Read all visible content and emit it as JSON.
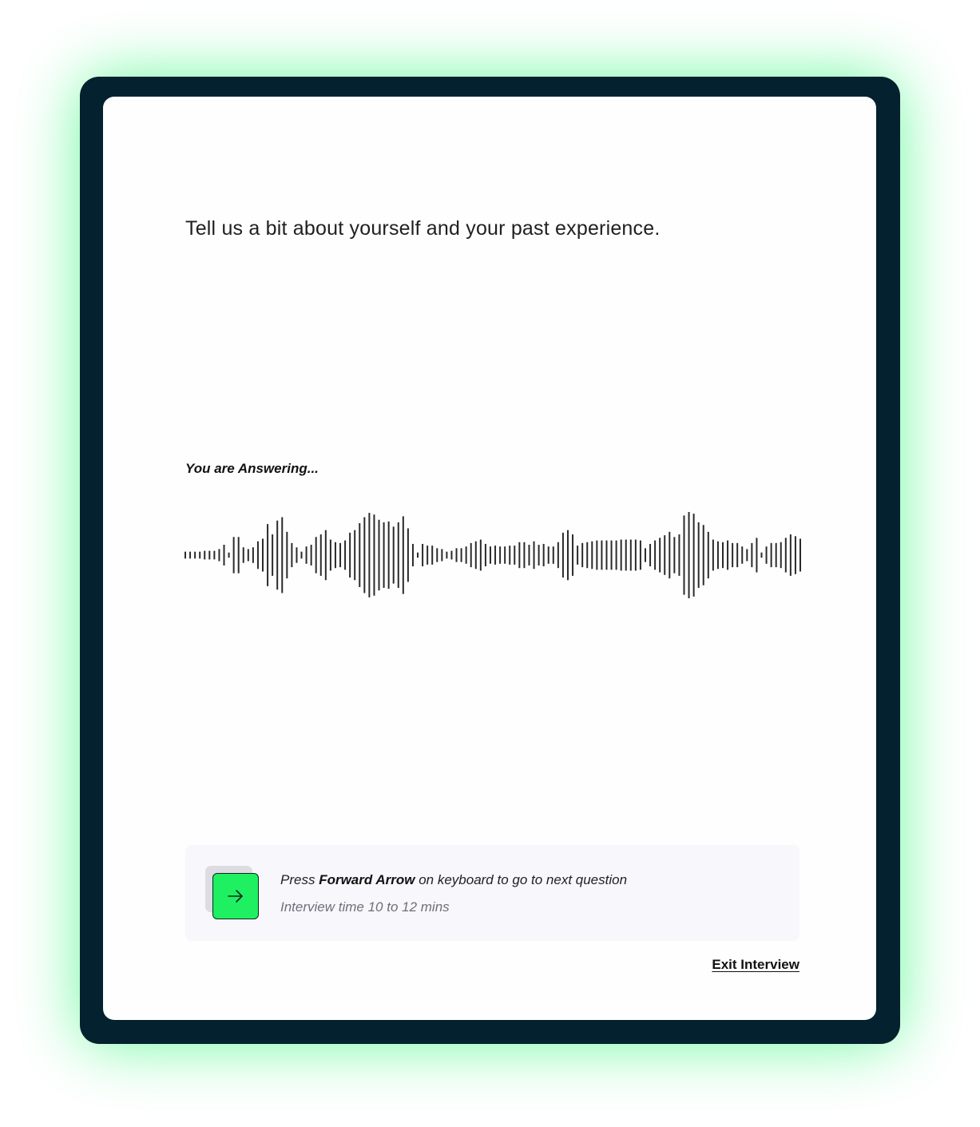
{
  "question": {
    "text": "Tell us a bit about yourself and your past experience."
  },
  "recording": {
    "status_label": "You are Answering...",
    "waveform_levels": [
      0.08,
      0.08,
      0.08,
      0.08,
      0.1,
      0.1,
      0.1,
      0.14,
      0.24,
      0.06,
      0.42,
      0.42,
      0.18,
      0.14,
      0.18,
      0.32,
      0.38,
      0.72,
      0.48,
      0.8,
      0.88,
      0.54,
      0.28,
      0.18,
      0.08,
      0.2,
      0.24,
      0.42,
      0.48,
      0.58,
      0.36,
      0.3,
      0.28,
      0.34,
      0.52,
      0.58,
      0.74,
      0.88,
      0.98,
      0.94,
      0.82,
      0.76,
      0.78,
      0.66,
      0.76,
      0.9,
      0.62,
      0.26,
      0.06,
      0.26,
      0.22,
      0.22,
      0.16,
      0.14,
      0.08,
      0.1,
      0.16,
      0.16,
      0.2,
      0.28,
      0.32,
      0.36,
      0.26,
      0.2,
      0.22,
      0.2,
      0.2,
      0.22,
      0.22,
      0.3,
      0.3,
      0.24,
      0.32,
      0.24,
      0.26,
      0.2,
      0.2,
      0.3,
      0.52,
      0.58,
      0.48,
      0.22,
      0.28,
      0.3,
      0.32,
      0.34,
      0.34,
      0.34,
      0.34,
      0.34,
      0.36,
      0.36,
      0.36,
      0.36,
      0.34,
      0.16,
      0.26,
      0.34,
      0.4,
      0.46,
      0.54,
      0.42,
      0.48,
      0.92,
      1.0,
      0.96,
      0.76,
      0.7,
      0.54,
      0.36,
      0.32,
      0.3,
      0.34,
      0.28,
      0.28,
      0.2,
      0.14,
      0.28,
      0.4,
      0.06,
      0.2,
      0.28,
      0.28,
      0.3,
      0.4,
      0.48,
      0.44,
      0.38
    ]
  },
  "hint": {
    "key_icon": "arrow-right-icon",
    "line1_prefix": "Press ",
    "line1_key": "Forward Arrow",
    "line1_suffix": " on keyboard to go to next question",
    "line2": "Interview time 10 to 12 mins"
  },
  "actions": {
    "exit_label": "Exit Interview"
  },
  "colors": {
    "frame": "#03212f",
    "glow": "#3cf77e",
    "accent": "#1ff062",
    "card": "#fefefe",
    "hint_bg": "#f7f7fc",
    "wave": "#2a2a2a"
  }
}
